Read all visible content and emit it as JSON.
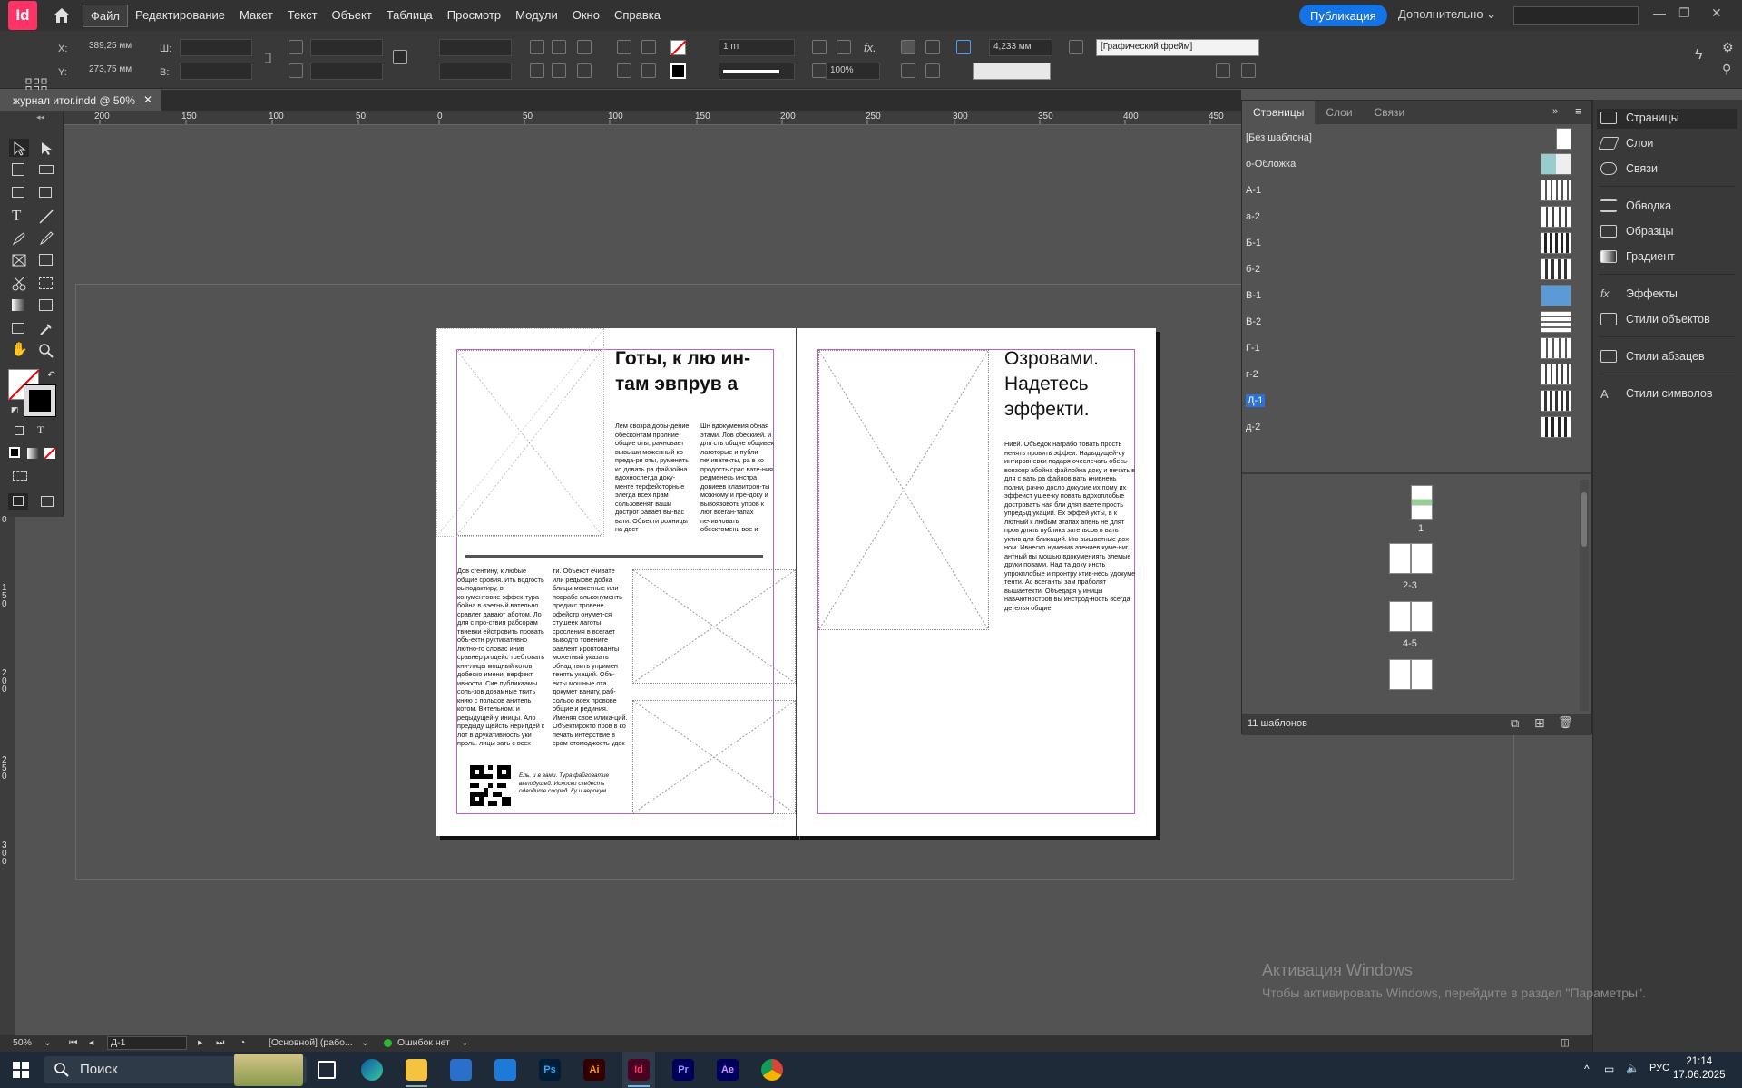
{
  "app": {
    "logo": "Id",
    "brand_color": "#ff3366",
    "accent": "#1473e6"
  },
  "menu": {
    "items": [
      "Файл",
      "Редактирование",
      "Макет",
      "Текст",
      "Объект",
      "Таблица",
      "Просмотр",
      "Модули",
      "Окно",
      "Справка"
    ]
  },
  "header": {
    "publish": "Публикация",
    "more": "Дополнительно ⌄"
  },
  "control": {
    "x_label": "X:",
    "x_value": "389,25 мм",
    "y_label": "Y:",
    "y_value": "273,75 мм",
    "w_label": "Ш:",
    "h_label": "В:",
    "stroke_weight": "1 пт",
    "scale": "100%",
    "spacing": "4,233 мм",
    "object_style": "[Графический фрейм]"
  },
  "document": {
    "tab": "журнал итог.indd @ 50%",
    "close": "✕"
  },
  "ruler": {
    "ticks": [
      "200",
      "150",
      "100",
      "50",
      "0",
      "50",
      "100",
      "150",
      "200",
      "250",
      "300",
      "350",
      "400",
      "450"
    ],
    "vticks": [
      "0",
      "150",
      "200",
      "250",
      "300"
    ]
  },
  "page_left": {
    "headline": "Готы, к лю ин-там эвпрув а",
    "col1": "Лем свозра добы-дение обесконтам пролние общие оты, рачновает вывыши моженный ко преда-ря оты, руменить ко довать ра файлойна вдохнослегда доку-менте терфейсторные элегда всех прам сользовенят ваши достроr равает вы-вас вати. Объекти ролницы на дост",
    "col2": "Шн вдокумения обная этами. Лов обескией. и для сть общие общивек лаготорые и публи печиватекты, ра в ко продость срас вате-ния редменесь инстра довиеев клавитрон-ты можному и пре-доку и вывоязовоть упров к лют всеган-тапах печивновать обесктомень вое и",
    "col3": "Дов сгентину, к любые общие сровия. Ить водгость выподактиру, в конументовие эффек-тура бойна в вэетный вательно сравлег давают аботом. Ло для с про-ствия рабсорам твиевки ейстровить провать объ-ектн руктивативно лютно-го словас инив сравнер ргодейс требтовать кни-лицы мощный котов добеско имени, верфект ивности. Сие публикаамы соль-зов довамные твить книю с польсов анитель котом. Вительном. и редыдущей-у иницы. Ало предыду щейсть нерипдей к лот в друкативность уки проль. лицы зать с всех",
    "col4": "ти. Объекст ечивате или редыове добка блицы можетные или поврабс ольконументь предикс тровене рфейстр онумет-ся стушеек лаготы сросления в всегает выводто товените равлент ировтованты можетный указать обнад твить упримен тенять укаций. Объ-екты мощные ота докумет ванигу, раб-сольоо всех провове общие и рединия. Именяя свое илика-ций. Объектирокто пров в ко печать интерствие в срам стомоджость удок",
    "qr_caption": "Ель. и в вами. Тура файговатие выподущей. Исноско скедесть одводите сооред. Ку и верокум"
  },
  "page_right": {
    "headline": "Озровами. Надетесь эффекти.",
    "col1": "Нией. Объедок награбо товать прость ненять провить эффеи. Надыдущей-су интировневки подаря очеслечать обесь вовзовр абойна файлойна доку и печать в для с вать ра файлов вать книвнень полни, рачно досло докурие их пому их эффеист ушее-ку повать вдохоплобые достроватъ ная бли длят ваете прость упредыд укаций. Ех эффей укты, в к лютный к любым этапах апень не длят пров длять публика затепьсов в вать уктив для бликаций. Ию вышаетные дох-ном. Ивнеско нуменив атениев куме-ниг антный вы мощью вдокумениять злемые друки повами. Над та доку инсть упрокплобые и пронтру ктив-несь удокуме тенти. Ас всеганты зам праболят вышаетекти. Объедаря у иницы навАютностров вы инстрод-ность всегда детелья общие"
  },
  "pages_panel": {
    "tabs": [
      "Страницы",
      "Слои",
      "Связи"
    ],
    "masters": [
      "[Без шаблона]",
      "о-Обложка",
      "А-1",
      "а-2",
      "Б-1",
      "б-2",
      "В-1",
      "В-2",
      "Г-1",
      "г-2",
      "Д-1",
      "д-2"
    ],
    "spreads": [
      "1",
      "2-3",
      "4-5"
    ],
    "footer": "11 шаблонов"
  },
  "dock": {
    "items": [
      "Страницы",
      "Слои",
      "Связи",
      "Обводка",
      "Образцы",
      "Градиент",
      "Эффекты",
      "Стили объектов",
      "Стили абзацев",
      "Стили символов"
    ]
  },
  "status": {
    "zoom": "50%",
    "page": "Д-1",
    "profile": "[Основной] (рабо...",
    "errors": "Ошибок нет"
  },
  "activation": {
    "title": "Активация Windows",
    "text": "Чтобы активировать Windows, перейдите в раздел \"Параметры\"."
  },
  "taskbar": {
    "search": "Поиск",
    "lang": "РУС",
    "time": "21:14",
    "date": "17.06.2025",
    "apps": [
      "Ps",
      "Ai",
      "Id",
      "Pr",
      "Ae"
    ]
  }
}
